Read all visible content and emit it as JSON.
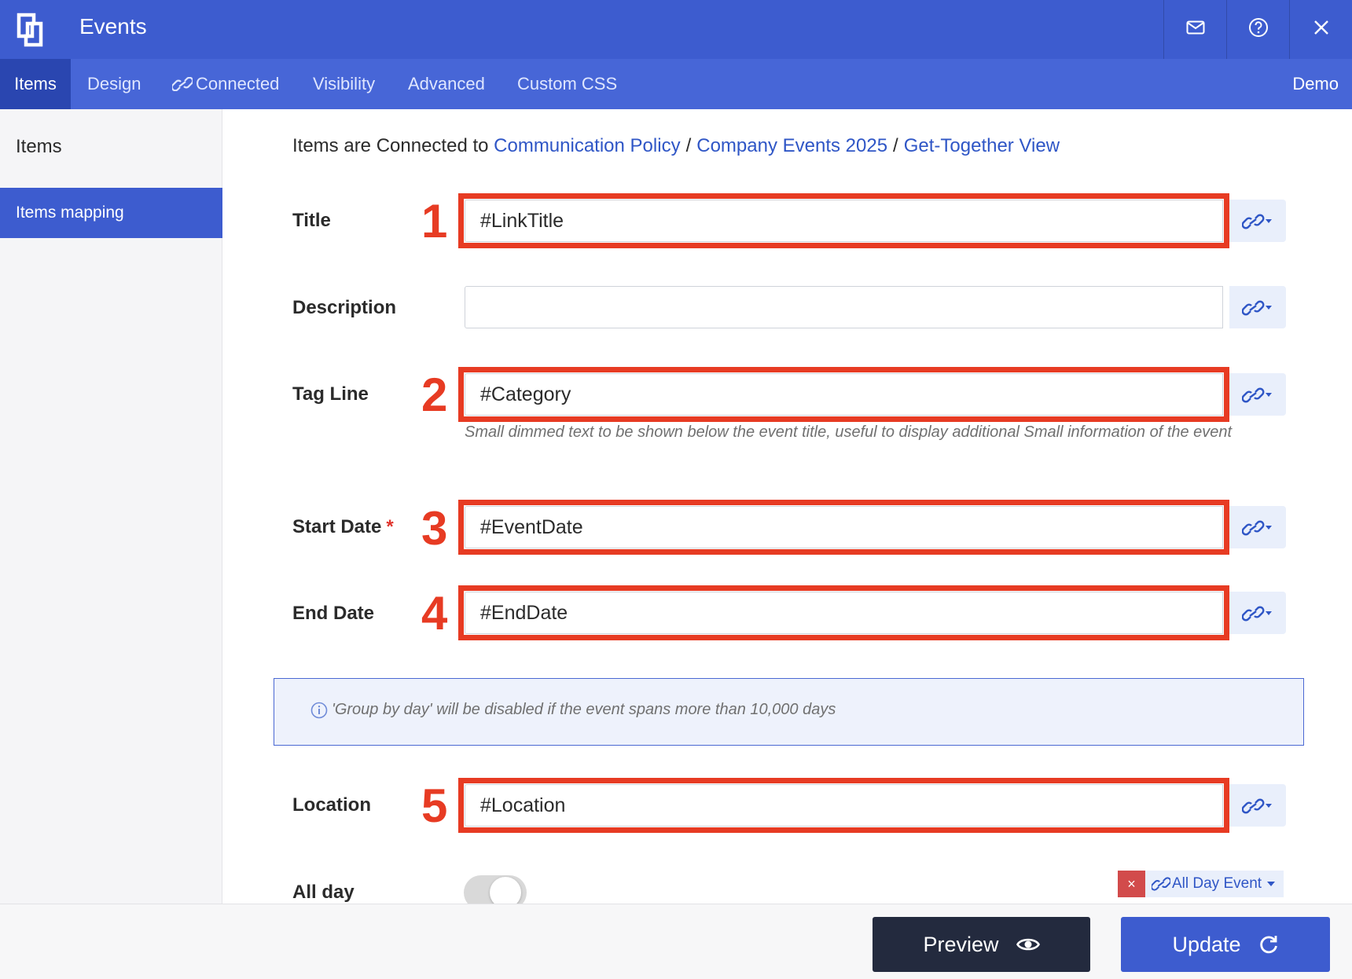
{
  "window": {
    "title": "Events"
  },
  "toolbar": {
    "mail_icon": "mail-icon",
    "help_icon": "help-icon",
    "close_icon": "close-icon"
  },
  "tabs": [
    {
      "label": "Items",
      "active": true
    },
    {
      "label": "Design",
      "active": false
    },
    {
      "label": "Connected",
      "active": false,
      "icon": "link-icon"
    },
    {
      "label": "Visibility",
      "active": false
    },
    {
      "label": "Advanced",
      "active": false
    },
    {
      "label": "Custom CSS",
      "active": false
    }
  ],
  "tabs_right": {
    "label": "Demo"
  },
  "sidebar": {
    "heading": "Items",
    "items": [
      {
        "label": "Items mapping",
        "active": true
      }
    ]
  },
  "breadcrumb": {
    "prefix": "Items are Connected to",
    "links": [
      "Communication Policy",
      "Company Events 2025",
      "Get-Together View"
    ],
    "separator": "/"
  },
  "fields": [
    {
      "label": "Title",
      "value": "#LinkTitle",
      "marker": "1"
    },
    {
      "label": "Description",
      "value": ""
    },
    {
      "label": "Tag Line",
      "value": "#Category",
      "marker": "2",
      "hint": "Small dimmed text to be shown below the event title, useful to display additional Small information of the event"
    },
    {
      "label": "Start Date",
      "value": "#EventDate",
      "marker": "3",
      "required_mark": "*"
    },
    {
      "label": "End Date",
      "value": "#EndDate",
      "marker": "4"
    },
    {
      "label": "Location",
      "value": "#Location",
      "marker": "5"
    }
  ],
  "info": {
    "icon": "info-icon",
    "text": "'Group by day' will be disabled if the event spans more than 10,000 days"
  },
  "all_day": {
    "label": "All day",
    "enabled": false,
    "tag_remove": "×",
    "tag_label": "All Day Event"
  },
  "footer": {
    "preview_label": "Preview",
    "update_label": "Update"
  },
  "colors": {
    "primary": "#3d5ccf",
    "tab_bar": "#4766d7",
    "active_tab": "#2a46b0",
    "highlight": "#e73b23",
    "link": "#2f56c6",
    "preview_button": "#232a3e"
  }
}
